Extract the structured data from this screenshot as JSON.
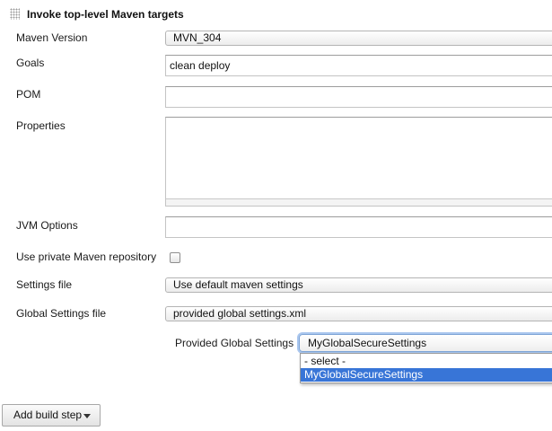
{
  "section": {
    "title": "Invoke top-level Maven targets"
  },
  "fields": {
    "maven_version": {
      "label": "Maven Version",
      "value": "MVN_304"
    },
    "goals": {
      "label": "Goals",
      "value": "clean deploy"
    },
    "pom": {
      "label": "POM",
      "value": ""
    },
    "properties": {
      "label": "Properties",
      "value": ""
    },
    "jvm_options": {
      "label": "JVM Options",
      "value": ""
    },
    "use_private_repo": {
      "label": "Use private Maven repository",
      "checked": false
    },
    "settings_file": {
      "label": "Settings file",
      "value": "Use default maven settings"
    },
    "global_settings_file": {
      "label": "Global Settings file",
      "value": "provided global settings.xml"
    },
    "provided_global_settings": {
      "label": "Provided Global Settings",
      "value": "MyGlobalSecureSettings",
      "options": [
        "- select -",
        "MyGlobalSecureSettings"
      ],
      "selected_option": "MyGlobalSecureSettings"
    }
  },
  "actions": {
    "add_build_step": "Add build step"
  },
  "colors": {
    "selection_highlight": "#3875d7",
    "focus_ring": "#a9c6ee"
  }
}
